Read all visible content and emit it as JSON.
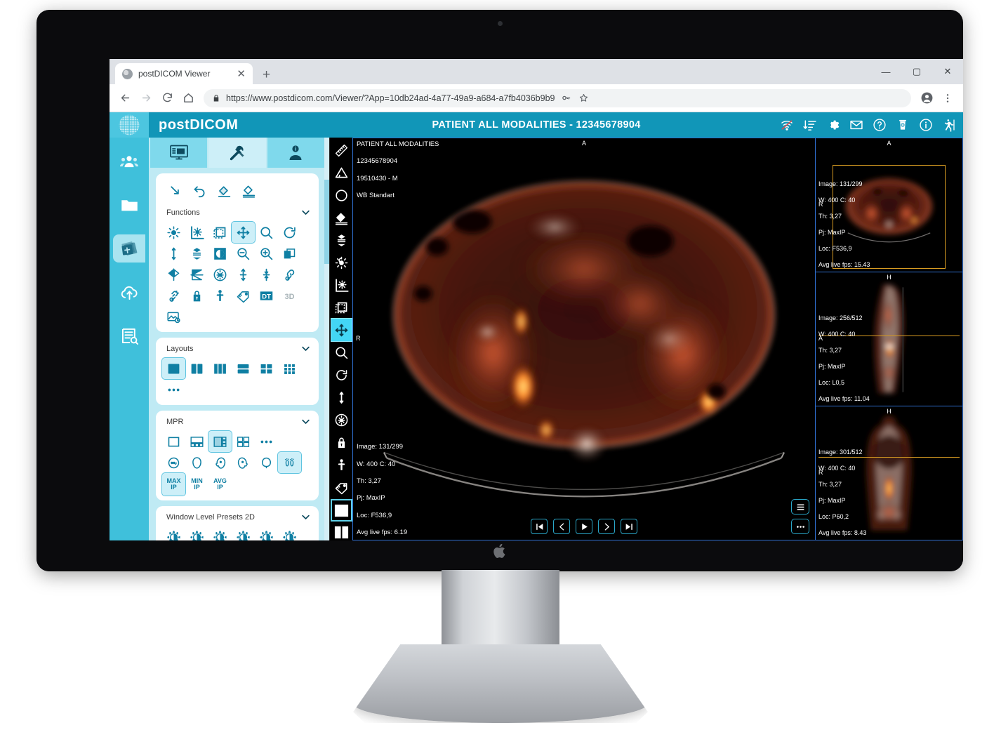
{
  "browser": {
    "tab_title": "postDICOM Viewer",
    "tab_close": "✕",
    "new_tab": "+",
    "url": "https://www.postdicom.com/Viewer/?App=10db24ad-4a77-49a9-a684-a7fb4036b9b9",
    "minimize": "—",
    "maximize": "▢",
    "close": "✕",
    "back_icon": "back-arrow-icon",
    "forward_icon": "forward-arrow-icon",
    "reload_icon": "reload-icon",
    "home_icon": "home-icon",
    "lock_icon": "lock-icon",
    "key_icon": "key-icon",
    "star_icon": "star-icon",
    "profile_icon": "profile-icon",
    "menu_icon": "kebab-menu-icon"
  },
  "header": {
    "brand": "postDICOM",
    "title": "PATIENT ALL MODALITIES - 12345678904",
    "accent": "#1196b8",
    "logo_bg": "#4cc6e0",
    "icons": [
      {
        "name": "wifi-off-icon"
      },
      {
        "name": "sort-descending-icon"
      },
      {
        "name": "gear-icon"
      },
      {
        "name": "mail-icon"
      },
      {
        "name": "help-icon"
      },
      {
        "name": "delete-study-icon"
      },
      {
        "name": "info-icon"
      },
      {
        "name": "exit-icon"
      }
    ]
  },
  "rail": {
    "items": [
      {
        "name": "sidebar-item-patients",
        "active": false
      },
      {
        "name": "sidebar-item-folders",
        "active": false
      },
      {
        "name": "sidebar-item-studies",
        "active": true
      },
      {
        "name": "sidebar-item-upload",
        "active": false
      },
      {
        "name": "sidebar-item-reports",
        "active": false
      }
    ]
  },
  "toolpanel": {
    "tabs": [
      {
        "name": "tab-study",
        "active": false
      },
      {
        "name": "tab-tools",
        "active": true
      },
      {
        "name": "tab-patient-info",
        "active": false
      }
    ],
    "quick_actions": [
      {
        "name": "cursor-arrow-icon"
      },
      {
        "name": "undo-icon"
      },
      {
        "name": "erase-annotation-icon"
      },
      {
        "name": "erase-all-icon"
      }
    ],
    "sections": [
      {
        "title": "Functions",
        "tools": [
          {
            "name": "brightness-icon",
            "sel": false
          },
          {
            "name": "window-level-icon",
            "sel": false
          },
          {
            "name": "roi-select-icon",
            "sel": false
          },
          {
            "name": "pan-icon",
            "sel": true
          },
          {
            "name": "zoom-icon",
            "sel": false
          },
          {
            "name": "rotate-icon",
            "sel": false
          },
          {
            "name": "flip-vertical-icon",
            "sel": false
          },
          {
            "name": "stack-scroll-icon",
            "sel": false
          },
          {
            "name": "invert-icon",
            "sel": false
          },
          {
            "name": "zoom-out-icon",
            "sel": false
          },
          {
            "name": "zoom-in-icon",
            "sel": false
          },
          {
            "name": "fit-window-icon",
            "sel": false
          },
          {
            "name": "flip-horizontal-icon",
            "sel": false
          },
          {
            "name": "flip-vertical-image-icon",
            "sel": false
          },
          {
            "name": "reset-icon",
            "sel": false
          },
          {
            "name": "vertical-resize-icon",
            "sel": false
          },
          {
            "name": "collapse-icon",
            "sel": false
          },
          {
            "name": "link-series-icon",
            "sel": false
          },
          {
            "name": "unlink-series-icon",
            "sel": false
          },
          {
            "name": "lock-icon",
            "sel": false
          },
          {
            "name": "patient-orientation-icon",
            "sel": false
          },
          {
            "name": "tag-icon",
            "sel": false
          },
          {
            "name": "dt-icon",
            "sel": false
          },
          {
            "name": "three-d-icon",
            "sel": false,
            "disabled": true
          },
          {
            "name": "image-settings-icon",
            "sel": false
          }
        ]
      },
      {
        "title": "Layouts",
        "tools": [
          {
            "name": "layout-1x1-icon",
            "sel": true
          },
          {
            "name": "layout-1x2-icon",
            "sel": false
          },
          {
            "name": "layout-1x3-icon",
            "sel": false
          },
          {
            "name": "layout-2x1-icon",
            "sel": false
          },
          {
            "name": "layout-2x2-icon",
            "sel": false
          },
          {
            "name": "layout-3x3-icon",
            "sel": false
          },
          {
            "name": "layout-more-icon",
            "sel": false
          }
        ]
      },
      {
        "title": "MPR",
        "tools": [
          {
            "name": "mpr-single-icon",
            "sel": false
          },
          {
            "name": "mpr-one-plus-three-icon",
            "sel": false
          },
          {
            "name": "mpr-side-stack-icon",
            "sel": true
          },
          {
            "name": "mpr-quad-icon",
            "sel": false
          },
          {
            "name": "mpr-more-icon",
            "sel": false
          },
          {
            "name": "orientation-axial-icon",
            "sel": false
          },
          {
            "name": "orientation-coronal-icon",
            "sel": false
          },
          {
            "name": "orientation-sagittal-left-icon",
            "sel": false
          },
          {
            "name": "orientation-sagittal-right-icon",
            "sel": false
          },
          {
            "name": "orientation-vertex-icon",
            "sel": false
          },
          {
            "name": "orientation-feet-icon",
            "sel": true
          }
        ],
        "projections": [
          {
            "name": "maxip-button",
            "line1": "MAX",
            "line2": "IP",
            "sel": true
          },
          {
            "name": "minip-button",
            "line1": "MIN",
            "line2": "IP",
            "sel": false
          },
          {
            "name": "avgip-button",
            "line1": "AVG",
            "line2": "IP",
            "sel": false
          }
        ]
      },
      {
        "title": "Window Level Presets 2D",
        "tools": [
          {
            "name": "preset-1-icon",
            "sel": false
          },
          {
            "name": "preset-2-icon",
            "sel": false
          },
          {
            "name": "preset-3-icon",
            "sel": false
          },
          {
            "name": "preset-4-icon",
            "sel": false
          },
          {
            "name": "preset-5-icon",
            "sel": false
          },
          {
            "name": "preset-6-icon",
            "sel": false
          },
          {
            "name": "preset-7-icon",
            "sel": false
          }
        ]
      }
    ]
  },
  "vtoolbar": {
    "tools": [
      {
        "name": "ruler-icon",
        "sel": false
      },
      {
        "name": "angle-icon",
        "sel": false
      },
      {
        "name": "ellipse-roi-icon",
        "sel": false
      },
      {
        "name": "eraser-icon",
        "sel": false
      },
      {
        "name": "stack-scroll-icon",
        "sel": false
      },
      {
        "name": "brightness-icon",
        "sel": false
      },
      {
        "name": "window-level-icon",
        "sel": false
      },
      {
        "name": "roi-select-icon",
        "sel": false
      },
      {
        "name": "pan-icon",
        "sel": true
      },
      {
        "name": "zoom-icon",
        "sel": false
      },
      {
        "name": "rotate-icon",
        "sel": false
      },
      {
        "name": "flip-vertical-icon",
        "sel": false
      },
      {
        "name": "reset-icon",
        "sel": false
      },
      {
        "name": "lock-icon",
        "sel": false
      },
      {
        "name": "patient-orientation-icon",
        "sel": false
      },
      {
        "name": "tag-icon",
        "sel": false
      }
    ],
    "layouts": [
      {
        "name": "layout-1x1-icon",
        "sel": true
      },
      {
        "name": "layout-1x2-icon",
        "sel": false
      }
    ]
  },
  "viewports": {
    "main": {
      "patient_name": "PATIENT ALL MODALITIES",
      "patient_id": "12345678904",
      "patient_dob_sex": "19510430 - M",
      "series_desc": "WB Standart",
      "orient_top": "A",
      "orient_left": "R",
      "image": "Image: 131/299",
      "window": "W: 400 C: 40",
      "thickness": "Th: 3,27",
      "projection": "Pj: MaxIP",
      "location": "Loc: F536,9",
      "fps": "Avg live fps: 6.19"
    },
    "playback": [
      {
        "name": "first-frame-button",
        "icon": "skip-start-icon"
      },
      {
        "name": "previous-frame-button",
        "icon": "chevron-left-icon"
      },
      {
        "name": "play-button",
        "icon": "play-icon"
      },
      {
        "name": "next-frame-button",
        "icon": "chevron-right-icon"
      },
      {
        "name": "last-frame-button",
        "icon": "skip-end-icon"
      }
    ],
    "corner_buttons": [
      {
        "name": "viewport-menu-button",
        "icon": "hamburger-icon"
      },
      {
        "name": "viewport-more-button",
        "icon": "ellipsis-icon"
      }
    ],
    "side": [
      {
        "name": "thumbnail-viewport-axial",
        "orient_top": "A",
        "orient_left": "R",
        "image": "Image: 131/299",
        "window": "W: 400 C: 40",
        "thickness": "Th: 3,27",
        "projection": "Pj: MaxIP",
        "location": "Loc: F536,9",
        "fps": "Avg live fps: 15.43"
      },
      {
        "name": "thumbnail-viewport-sagittal",
        "orient_top": "H",
        "orient_left": "A",
        "image": "Image: 256/512",
        "window": "W: 400 C: 40",
        "thickness": "Th: 3,27",
        "projection": "Pj: MaxIP",
        "location": "Loc: L0,5",
        "fps": "Avg live fps: 11.04"
      },
      {
        "name": "thumbnail-viewport-coronal",
        "orient_top": "H",
        "orient_left": "R",
        "image": "Image: 301/512",
        "window": "W: 400 C: 40",
        "thickness": "Th: 3,27",
        "projection": "Pj: MaxIP",
        "location": "Loc: P60,2",
        "fps": "Avg live fps: 8.43"
      }
    ]
  }
}
